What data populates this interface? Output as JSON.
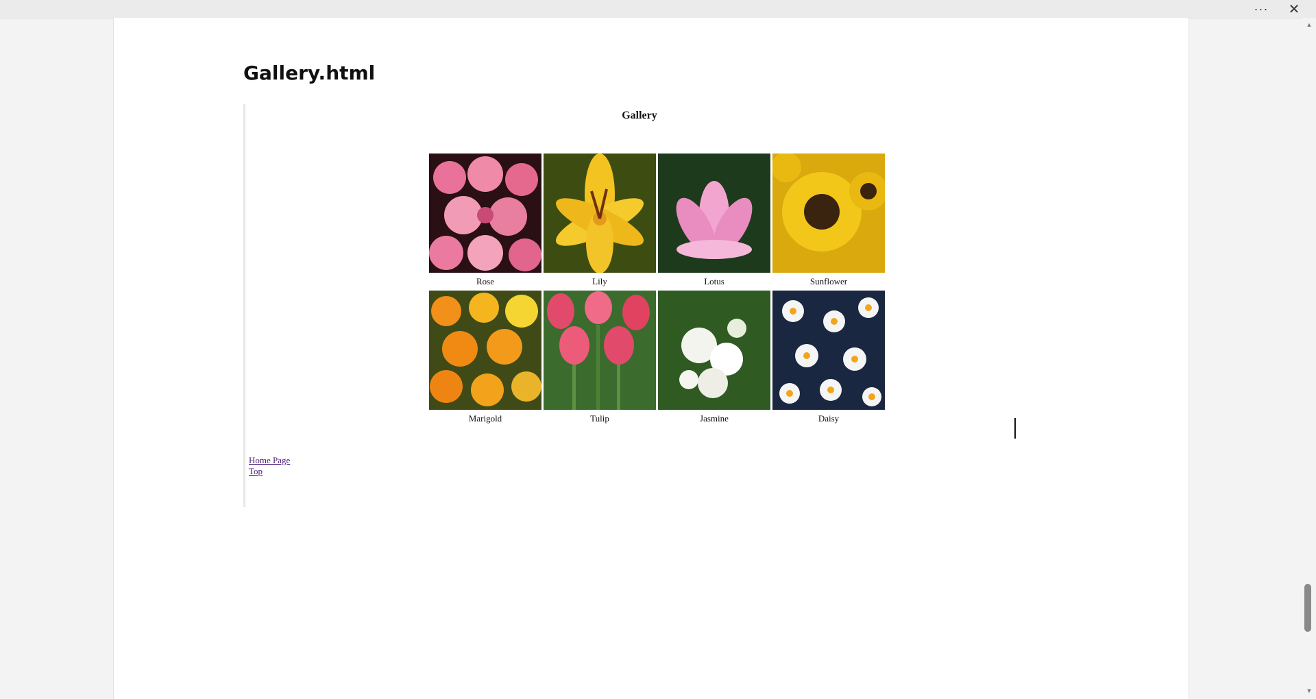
{
  "window": {
    "more_icon": "more-icon",
    "close_icon": "close-icon",
    "more_glyph": "···",
    "close_glyph": "✕"
  },
  "document": {
    "title": "Gallery.html"
  },
  "gallery": {
    "heading": "Gallery",
    "items": [
      {
        "label": "Rose",
        "color": "#e36b8f"
      },
      {
        "label": "Lily",
        "color": "#f0c22b"
      },
      {
        "label": "Lotus",
        "color": "#e98cc0"
      },
      {
        "label": "Sunflower",
        "color": "#e5b611"
      },
      {
        "label": "Marigold",
        "color": "#f28f1a"
      },
      {
        "label": "Tulip",
        "color": "#e14a6a"
      },
      {
        "label": "Jasmine",
        "color": "#f4f4ee"
      },
      {
        "label": "Daisy",
        "color": "#f5f5f5"
      }
    ]
  },
  "links": {
    "home": "Home Page",
    "top": "Top"
  }
}
